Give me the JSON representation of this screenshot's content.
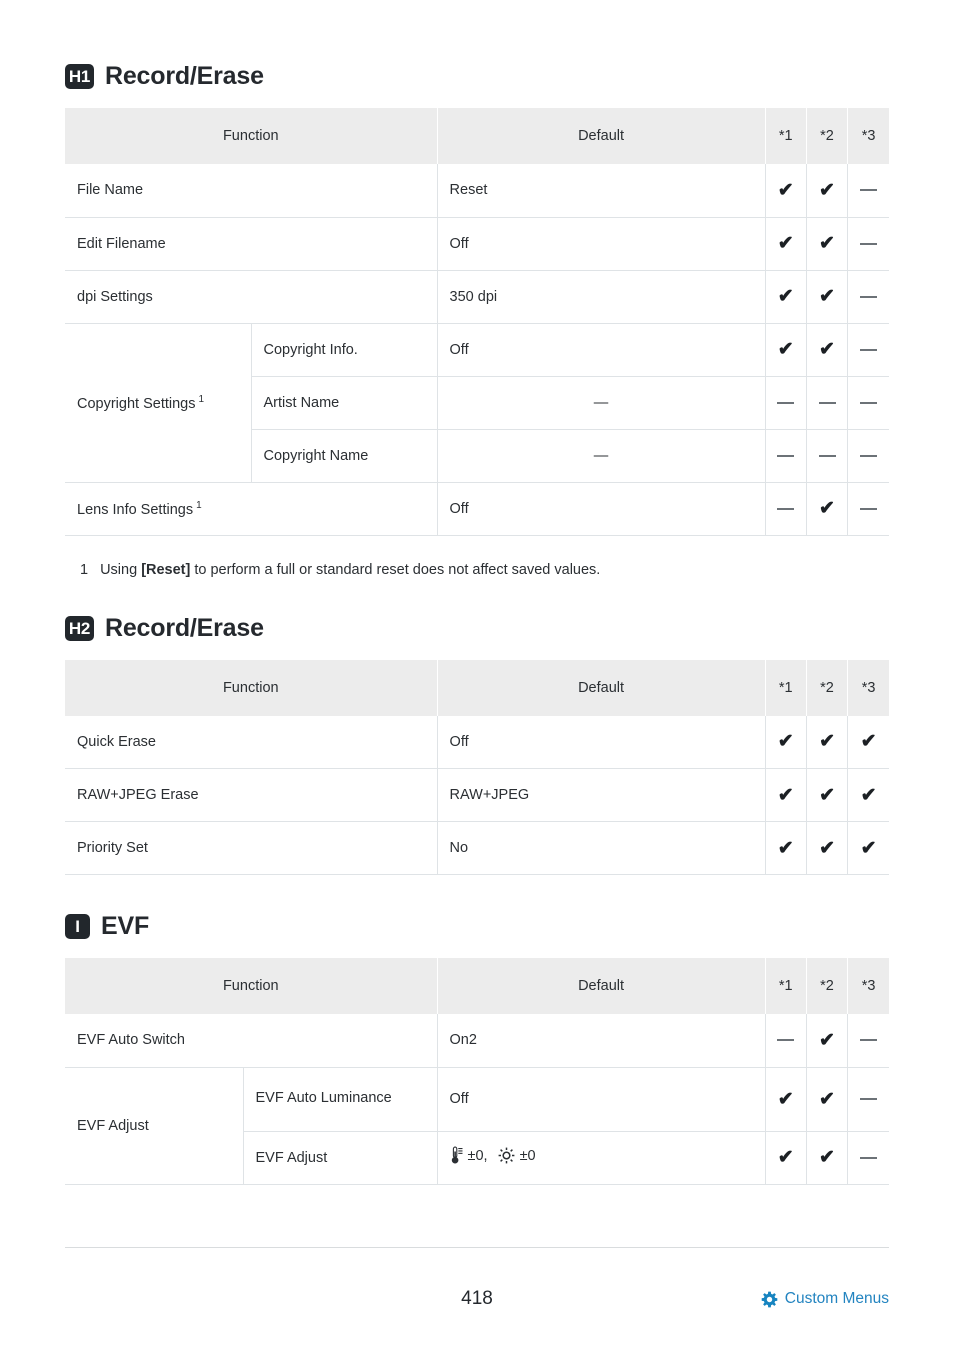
{
  "page": {
    "number": "418",
    "footer_link_label": "Custom Menus",
    "footer_link_icon": "gear-icon"
  },
  "table_headers": {
    "function": "Function",
    "default": "Default",
    "star1": "*1",
    "star2": "*2",
    "star3": "*3"
  },
  "marks": {
    "check": "✔",
    "dash": "—"
  },
  "sections": [
    {
      "badge": "H1",
      "title": "Record/Erase",
      "rows": [
        {
          "function": "File Name",
          "sub": null,
          "footnote": null,
          "default": "Reset",
          "s1": "check",
          "s2": "check",
          "s3": "dash"
        },
        {
          "function": "Edit Filename",
          "sub": null,
          "footnote": null,
          "default": "Off",
          "s1": "check",
          "s2": "check",
          "s3": "dash"
        },
        {
          "function": "dpi Settings",
          "sub": null,
          "footnote": null,
          "default": "350 dpi",
          "s1": "check",
          "s2": "check",
          "s3": "dash"
        },
        {
          "function": "Copyright Settings",
          "sub": "Copyright Info.",
          "footnote": "1",
          "default": "Off",
          "s1": "check",
          "s2": "check",
          "s3": "dash"
        },
        {
          "function": null,
          "sub": "Artist Name",
          "footnote": null,
          "default": "—",
          "s1": "dash",
          "s2": "dash",
          "s3": "dash"
        },
        {
          "function": null,
          "sub": "Copyright Name",
          "footnote": null,
          "default": "—",
          "s1": "dash",
          "s2": "dash",
          "s3": "dash"
        },
        {
          "function": "Lens Info Settings",
          "sub": null,
          "footnote": "1",
          "default": "Off",
          "s1": "dash",
          "s2": "check",
          "s3": "dash"
        }
      ],
      "footnotes": [
        {
          "num": "1",
          "pre": "Using ",
          "bold": "[Reset]",
          "post": " to perform a full or standard reset does not affect saved values."
        }
      ]
    },
    {
      "badge": "H2",
      "title": "Record/Erase",
      "rows": [
        {
          "function": "Quick Erase",
          "sub": null,
          "footnote": null,
          "default": "Off",
          "s1": "check",
          "s2": "check",
          "s3": "check"
        },
        {
          "function": "RAW+JPEG Erase",
          "sub": null,
          "footnote": null,
          "default": "RAW+JPEG",
          "s1": "check",
          "s2": "check",
          "s3": "check"
        },
        {
          "function": "Priority Set",
          "sub": null,
          "footnote": null,
          "default": "No",
          "s1": "check",
          "s2": "check",
          "s3": "check"
        }
      ],
      "footnotes": []
    },
    {
      "badge": "I",
      "title": "EVF",
      "rows": [
        {
          "function": "EVF Auto Switch",
          "sub": null,
          "footnote": null,
          "default": "On2",
          "s1": "dash",
          "s2": "check",
          "s3": "dash"
        },
        {
          "function": "EVF Adjust",
          "sub": "EVF Auto Luminance",
          "footnote": null,
          "default": "Off",
          "s1": "check",
          "s2": "check",
          "s3": "dash"
        },
        {
          "function": null,
          "sub": "EVF Adjust",
          "footnote": null,
          "default_icons": [
            {
              "icon": "thermometer-icon",
              "value": "±0,"
            },
            {
              "icon": "brightness-sun-icon",
              "value": "±0"
            }
          ],
          "s1": "check",
          "s2": "check",
          "s3": "dash"
        }
      ],
      "footnotes": []
    }
  ]
}
